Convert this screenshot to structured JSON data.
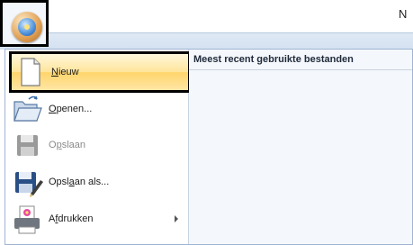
{
  "titlebar": {
    "title": "N"
  },
  "menu": {
    "recent_header": "Meest recent gebruikte bestanden",
    "items": [
      {
        "label": "Nieuw",
        "access": "N",
        "icon": "new-document-icon",
        "state": "selected"
      },
      {
        "label": "Openen...",
        "access": "O",
        "icon": "open-folder-icon",
        "state": "normal"
      },
      {
        "label": "Opslaan",
        "access": "p",
        "icon": "save-disk-icon",
        "state": "disabled"
      },
      {
        "label": "Opslaan als...",
        "access": "a",
        "icon": "save-as-icon",
        "state": "normal"
      },
      {
        "label": "Afdrukken",
        "access": "f",
        "icon": "printer-icon",
        "state": "normal",
        "submenu": true
      }
    ]
  },
  "colors": {
    "selection": "#ffe59a",
    "menu_bg": "#e9eef6",
    "ribbon": "#dfe9f5"
  }
}
